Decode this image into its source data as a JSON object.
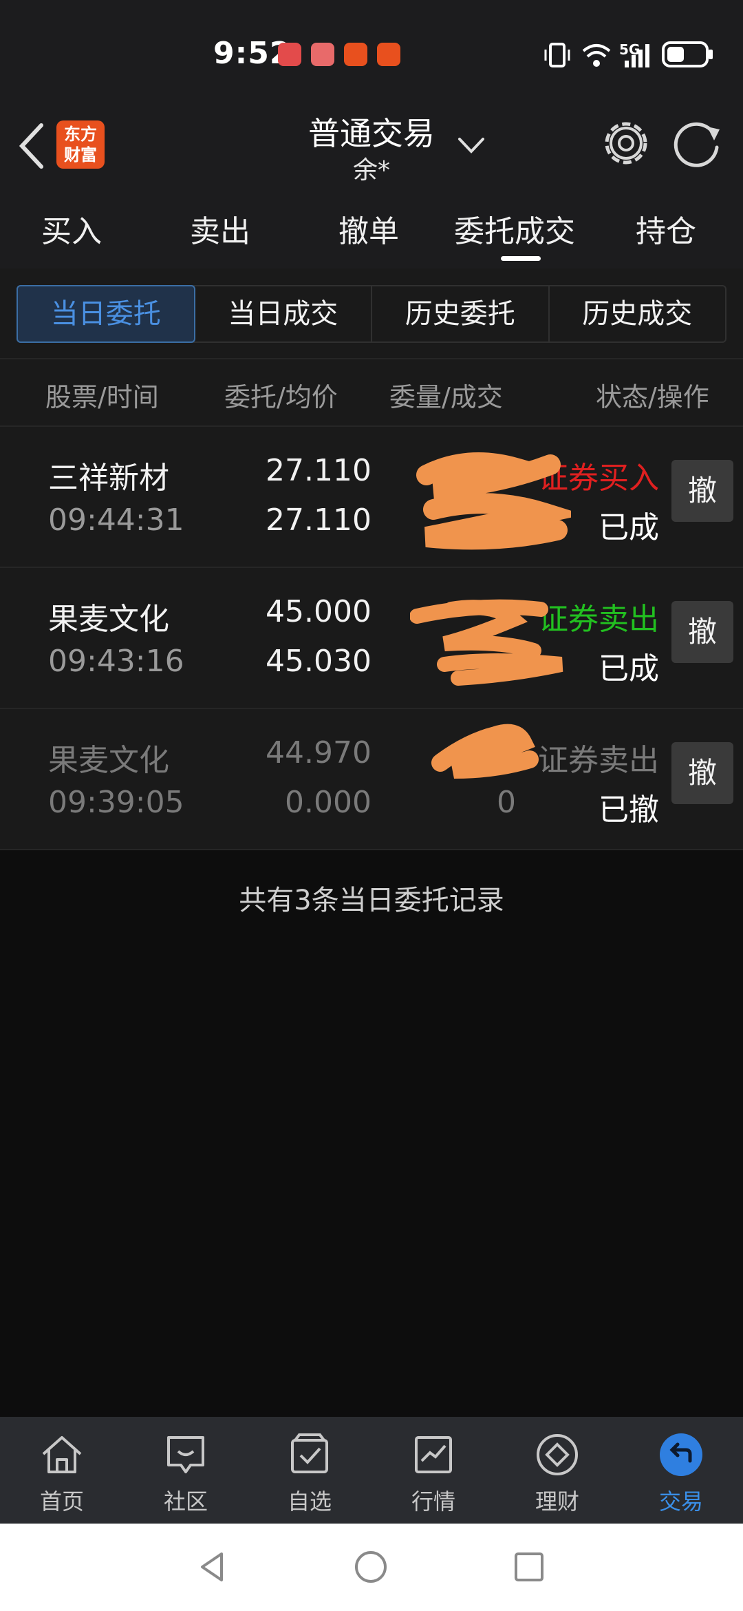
{
  "status_bar": {
    "time": "9:52",
    "network": "5G",
    "notification_icons": [
      "huawei-app-icon",
      "book-app-icon",
      "eastmoney-app-icon",
      "eastmoney-app-icon"
    ]
  },
  "header": {
    "logo_text_line1": "东方",
    "logo_text_line2": "财富",
    "title": "普通交易",
    "account": "余*",
    "logo_color": "#e8501e"
  },
  "top_tabs": [
    {
      "label": "买入"
    },
    {
      "label": "卖出"
    },
    {
      "label": "撤单"
    },
    {
      "label": "委托成交",
      "active": true
    },
    {
      "label": "持仓"
    }
  ],
  "segments": [
    {
      "label": "当日委托",
      "active": true
    },
    {
      "label": "当日成交"
    },
    {
      "label": "历史委托"
    },
    {
      "label": "历史成交"
    }
  ],
  "columns": [
    "股票/时间",
    "委托/均价",
    "委量/成交",
    "状态/操作"
  ],
  "orders": [
    {
      "name": "三祥新材",
      "time": "09:44:31",
      "price": "27.110",
      "avg": "27.110",
      "qty": "",
      "filled": "",
      "direction": "证券买入",
      "direction_color": "#e02020",
      "status": "已成",
      "cancel": "撤"
    },
    {
      "name": "果麦文化",
      "time": "09:43:16",
      "price": "45.000",
      "avg": "45.030",
      "qty": "",
      "filled": "",
      "direction": "证券卖出",
      "direction_color": "#22c020",
      "status": "已成",
      "cancel": "撤"
    },
    {
      "name": "果麦文化",
      "time": "09:39:05",
      "price": "44.970",
      "avg": "0.000",
      "qty": "",
      "filled": "0",
      "direction": "证券卖出",
      "direction_color": "#7a7a7a",
      "status": "已撤",
      "cancel": "撤"
    }
  ],
  "summary": "共有3条当日委托记录",
  "bottom_nav": [
    {
      "label": "首页",
      "icon": "home-icon"
    },
    {
      "label": "社区",
      "icon": "community-icon"
    },
    {
      "label": "自选",
      "icon": "watchlist-icon"
    },
    {
      "label": "行情",
      "icon": "market-icon"
    },
    {
      "label": "理财",
      "icon": "finance-icon"
    },
    {
      "label": "交易",
      "icon": "trade-icon",
      "active": true
    }
  ],
  "accent_color": "#3a8fe8"
}
